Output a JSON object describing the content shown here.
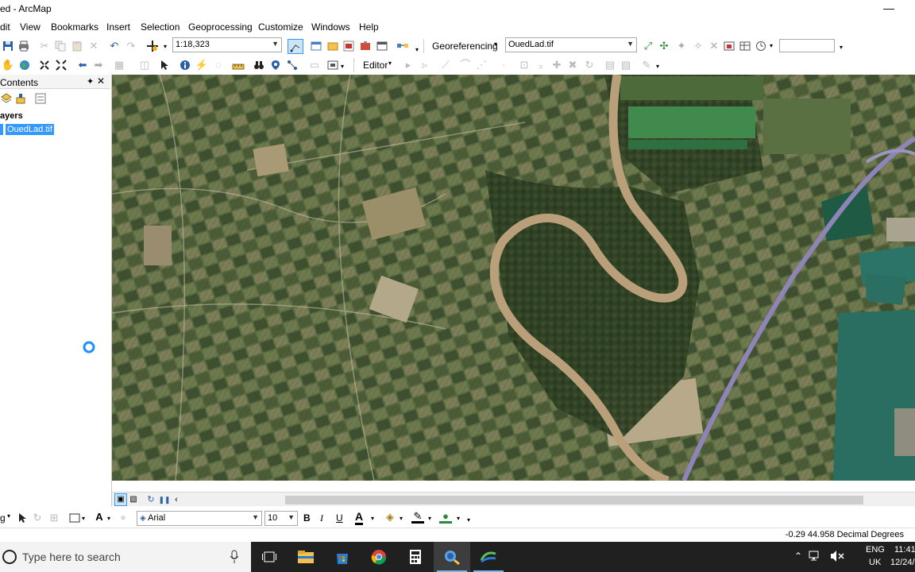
{
  "window": {
    "title": "ed - ArcMap",
    "minimize_glyph": "—"
  },
  "menubar": {
    "items": [
      "dit",
      "View",
      "Bookmarks",
      "Insert",
      "Selection",
      "Geoprocessing",
      "Customize",
      "Windows",
      "Help"
    ]
  },
  "standard_toolbar": {
    "scale_value": "1:18,323"
  },
  "georef_toolbar": {
    "label": "Georeferencing",
    "layer_value": "OuedLad.tif",
    "search_value": ""
  },
  "editor_toolbar": {
    "label": "Editor"
  },
  "toc": {
    "title": "Contents",
    "layers_heading": "ayers",
    "layer_name": "OuedLad.tif",
    "pin_glyph": "✦",
    "close_glyph": "✕"
  },
  "drawing_toolbar": {
    "drawing_label": "g",
    "font_name": "Arial",
    "font_size": "10",
    "bold": "B",
    "italic": "I",
    "underline": "U",
    "font_color_glyph": "A"
  },
  "statusbar": {
    "coordinates": "-0.29  44.958 Decimal Degrees"
  },
  "taskbar": {
    "search_placeholder": "Type here to search",
    "language": "ENG",
    "region": "UK",
    "time": "11:41",
    "date": "12/24/"
  },
  "colors": {
    "accent": "#3399ff",
    "selection_highlight": "#3399ff",
    "taskbar_bg": "#202020",
    "map_river": "#b9a07a",
    "map_highway": "#8e84b8",
    "map_water": "#2a6e62"
  },
  "icons": [
    "save-icon",
    "print-icon",
    "cut-icon",
    "copy-icon",
    "paste-icon",
    "delete-icon",
    "undo-icon",
    "redo-icon",
    "add-data-icon",
    "pan-icon",
    "globe-icon",
    "full-extent-icon",
    "back-icon",
    "forward-icon",
    "select-icon",
    "identify-icon",
    "find-icon",
    "loading-spinner-icon",
    "windows-start-icon",
    "microphone-icon",
    "task-view-icon",
    "file-explorer-icon",
    "store-icon",
    "chrome-icon",
    "calculator-icon",
    "arcmap-icon",
    "arcgis-pro-icon"
  ]
}
